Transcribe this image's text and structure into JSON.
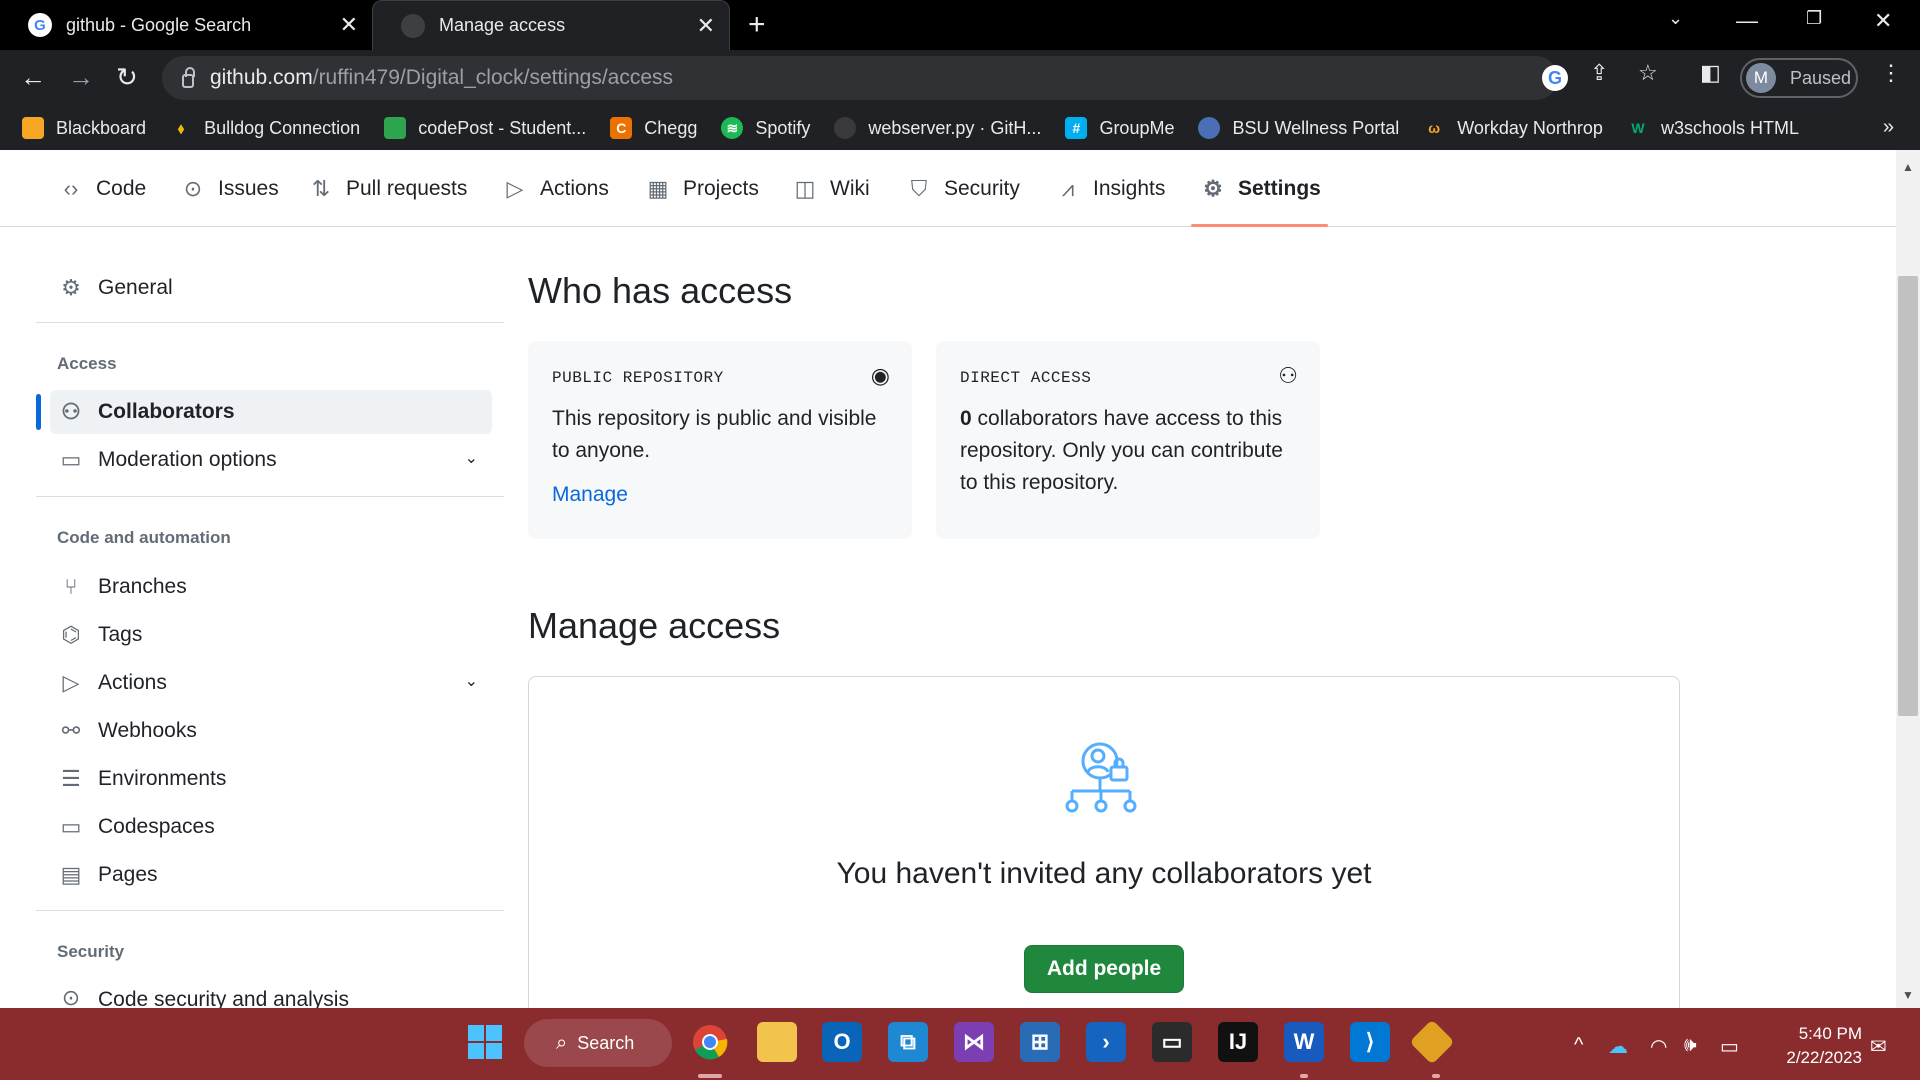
{
  "browser": {
    "tabs": [
      {
        "title": "github - Google Search",
        "favicon": "google-icon"
      },
      {
        "title": "Manage access",
        "favicon": "github-icon"
      }
    ],
    "url_host": "github.com",
    "url_path": "/ruffin479/Digital_clock/settings/access",
    "profile_initial": "M",
    "profile_status": "Paused",
    "bookmarks": [
      {
        "label": "Blackboard",
        "icon": "blackboard-icon",
        "color": "#f5a623"
      },
      {
        "label": "Bulldog Connection",
        "icon": "bulldog-icon",
        "color": "#f2b705"
      },
      {
        "label": "codePost - Student...",
        "icon": "codepost-icon",
        "color": "#2ea44f"
      },
      {
        "label": "Chegg",
        "icon": "chegg-icon",
        "color": "#eb7100"
      },
      {
        "label": "Spotify",
        "icon": "spotify-icon",
        "color": "#1db954"
      },
      {
        "label": "webserver.py · GitH...",
        "icon": "github-icon",
        "color": "#3a3a3a"
      },
      {
        "label": "GroupMe",
        "icon": "groupme-icon",
        "color": "#00aff0"
      },
      {
        "label": "BSU Wellness Portal",
        "icon": "globe-icon",
        "color": "#4a6fb5"
      },
      {
        "label": "Workday Northrop",
        "icon": "workday-icon",
        "color": "#f5a623"
      },
      {
        "label": "w3schools HTML",
        "icon": "w3schools-icon",
        "color": "#04aa6d"
      }
    ]
  },
  "repo_nav": [
    {
      "label": "Code",
      "icon": "code-icon"
    },
    {
      "label": "Issues",
      "icon": "issue-icon"
    },
    {
      "label": "Pull requests",
      "icon": "pull-request-icon"
    },
    {
      "label": "Actions",
      "icon": "play-icon"
    },
    {
      "label": "Projects",
      "icon": "table-icon"
    },
    {
      "label": "Wiki",
      "icon": "book-icon"
    },
    {
      "label": "Security",
      "icon": "shield-icon"
    },
    {
      "label": "Insights",
      "icon": "graph-icon"
    },
    {
      "label": "Settings",
      "icon": "gear-icon"
    }
  ],
  "sidebar": {
    "general": "General",
    "access_heading": "Access",
    "collaborators": "Collaborators",
    "moderation": "Moderation options",
    "code_heading": "Code and automation",
    "branches": "Branches",
    "tags": "Tags",
    "actions": "Actions",
    "webhooks": "Webhooks",
    "environments": "Environments",
    "codespaces": "Codespaces",
    "pages": "Pages",
    "security_heading": "Security",
    "code_security": "Code security and analysis"
  },
  "main": {
    "who_title": "Who has access",
    "public_card": {
      "label": "PUBLIC REPOSITORY",
      "text": "This repository is public and visible to anyone.",
      "link": "Manage"
    },
    "direct_card": {
      "label": "DIRECT ACCESS",
      "count": "0",
      "text": " collaborators have access to this repository. Only you can contribute to this repository."
    },
    "manage_title": "Manage access",
    "blank_title": "You haven't invited any collaborators yet",
    "add_button": "Add people"
  },
  "taskbar": {
    "search_label": "Search",
    "time": "5:40 PM",
    "date": "2/22/2023"
  },
  "colors": {
    "accent_blue": "#0969da",
    "green_button": "#1f883d",
    "taskbar": "#8a2b2e",
    "settings_underline": "#fd8c73"
  }
}
